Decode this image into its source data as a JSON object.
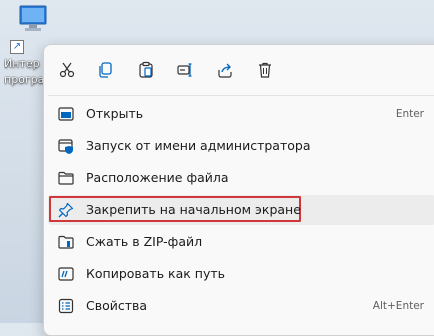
{
  "desktop": {
    "icon_label_line1": "Интер",
    "icon_label_line2": "програ"
  },
  "toolbar": {
    "icons": [
      "cut-icon",
      "copy-icon",
      "paste-icon",
      "rename-icon",
      "share-icon",
      "delete-icon"
    ]
  },
  "menu": {
    "items": [
      {
        "label": "Открыть",
        "shortcut": "Enter",
        "icon": "open-icon"
      },
      {
        "label": "Запуск от имени администратора",
        "shortcut": "",
        "icon": "run-as-admin-icon"
      },
      {
        "label": "Расположение файла",
        "shortcut": "",
        "icon": "folder-icon"
      },
      {
        "label": "Закрепить на начальном экране",
        "shortcut": "",
        "icon": "pin-icon"
      },
      {
        "label": "Сжать в ZIP-файл",
        "shortcut": "",
        "icon": "zip-icon"
      },
      {
        "label": "Копировать как путь",
        "shortcut": "",
        "icon": "copy-path-icon"
      },
      {
        "label": "Свойства",
        "shortcut": "Alt+Enter",
        "icon": "properties-icon"
      }
    ]
  },
  "colors": {
    "accent": "#0067c0",
    "highlight_border": "#d0373b"
  }
}
